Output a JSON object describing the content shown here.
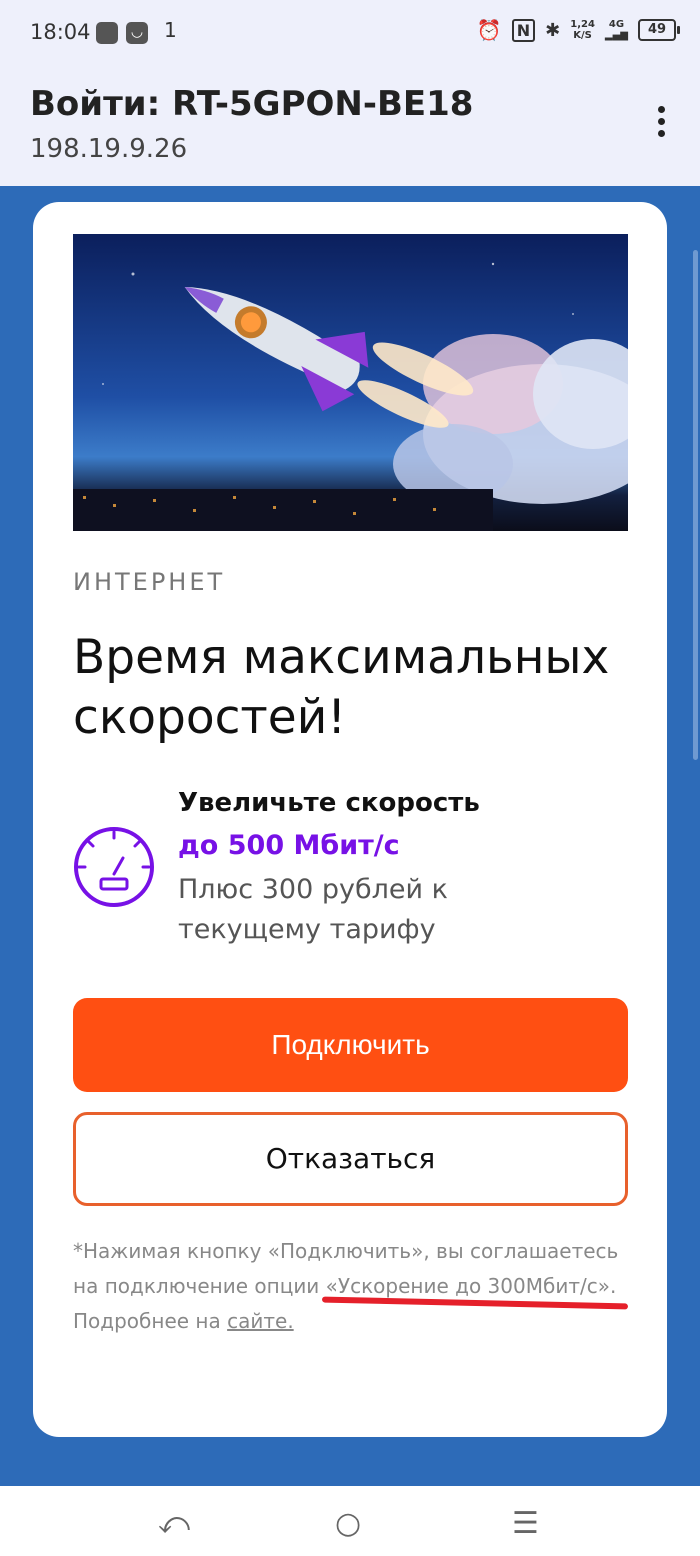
{
  "status_bar": {
    "time": "18:04",
    "notification": "1",
    "speed": "1,24",
    "speed_unit": "K/S",
    "network": "4G",
    "battery": "49",
    "icons": [
      "alarm-icon",
      "nfc-icon",
      "bluetooth-icon",
      "signal-icon"
    ]
  },
  "app_bar": {
    "title": "Войти: RT-5GPON-BE18",
    "subtitle": "198.19.9.26"
  },
  "card": {
    "overline": "ИНТЕРНЕТ",
    "headline": "Время максимальных скоростей!",
    "feature": {
      "title": "Увеличьте скорость",
      "accent": "до 500 Мбит/с",
      "description": "Плюс 300 рублей к текущему тарифу"
    },
    "primary_button": "Подключить",
    "secondary_button": "Отказаться",
    "disclaimer_text": "*Нажимая кнопку «Подключить», вы соглашаетесь на подключение опции «Ускорение до 300Мбит/с». Подробнее на ",
    "disclaimer_link": "сайте."
  },
  "colors": {
    "accent_orange": "#ff4f12",
    "accent_purple": "#7711e6",
    "background_blue": "#2d6bb8"
  }
}
